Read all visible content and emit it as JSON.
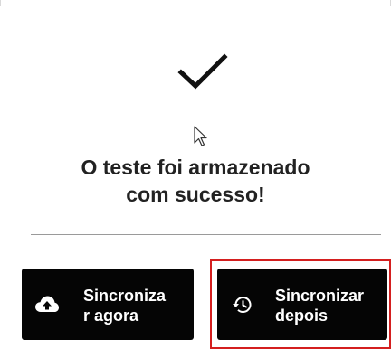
{
  "dialog": {
    "message_line1": "O teste foi armazenado",
    "message_line2": "com sucesso!"
  },
  "buttons": {
    "sync_now_label": "Sincroniza\nr agora",
    "sync_later_label": "Sincronizar\ndepois"
  },
  "icons": {
    "success": "checkmark-icon",
    "sync_now": "cloud-upload-icon",
    "sync_later": "history-icon",
    "pointer": "mouse-cursor-icon"
  },
  "colors": {
    "button_background": "#050505",
    "button_text": "#ffffff",
    "highlight_outline": "#d41f1f",
    "message_text": "#222222"
  }
}
